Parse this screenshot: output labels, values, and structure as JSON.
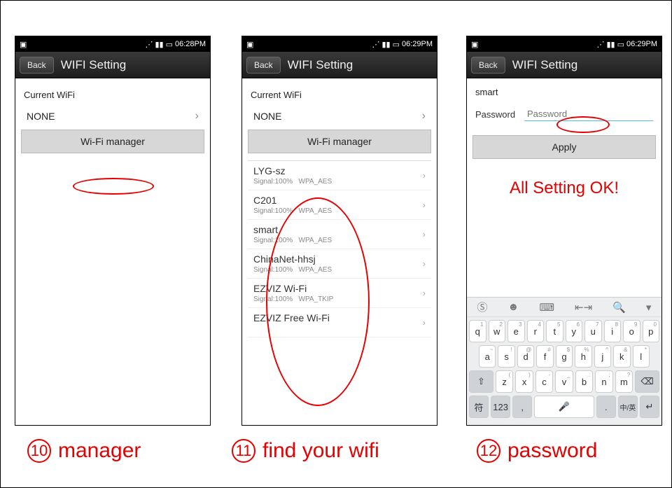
{
  "status": {
    "time1": "06:28PM",
    "time2": "06:29PM",
    "time3": "06:29PM"
  },
  "titlebar": {
    "back": "Back",
    "title": "WIFI Setting"
  },
  "current_label": "Current WiFi",
  "current_value": "NONE",
  "wifi_manager_btn": "Wi-Fi manager",
  "wifilist": [
    {
      "name": "LYG-sz",
      "signal": "Signal:100%",
      "sec": "WPA_AES"
    },
    {
      "name": "C201",
      "signal": "Signal:100%",
      "sec": "WPA_AES"
    },
    {
      "name": "smart",
      "signal": "Signal:100%",
      "sec": "WPA_AES"
    },
    {
      "name": "ChinaNet-hhsj",
      "signal": "Signal:100%",
      "sec": "WPA_AES"
    },
    {
      "name": "EZVIZ Wi-Fi",
      "signal": "Signal:100%",
      "sec": "WPA_TKIP"
    },
    {
      "name": "EZVIZ Free Wi-Fi",
      "signal": "",
      "sec": ""
    }
  ],
  "p3": {
    "ssid": "smart",
    "pwd_label": "Password",
    "pwd_placeholder": "Password",
    "apply": "Apply",
    "ok": "All Setting OK!"
  },
  "kb": {
    "row1": [
      "q",
      "w",
      "e",
      "r",
      "t",
      "y",
      "u",
      "i",
      "o",
      "p"
    ],
    "sub1": [
      "1",
      "2",
      "3",
      "4",
      "5",
      "6",
      "7",
      "8",
      "9",
      "0"
    ],
    "row2": [
      "a",
      "s",
      "d",
      "f",
      "g",
      "h",
      "j",
      "k",
      "l"
    ],
    "sub2": [
      "~",
      "!",
      "@",
      "#",
      "$",
      "%",
      "^",
      "&",
      "*"
    ],
    "row3": [
      "z",
      "x",
      "c",
      "v",
      "b",
      "n",
      "m"
    ],
    "sub3": [
      "(",
      ")",
      "-",
      "_",
      ":",
      ";",
      "?"
    ],
    "shift": "⇧",
    "bksp": "⌫",
    "sym": "符",
    "num": "123",
    "comma": ",",
    "period": ".",
    "lang": "中/英"
  },
  "captions": {
    "n10": "10",
    "t10": "manager",
    "n11": "11",
    "t11": "find  your wifi",
    "n12": "12",
    "t12": "password"
  }
}
